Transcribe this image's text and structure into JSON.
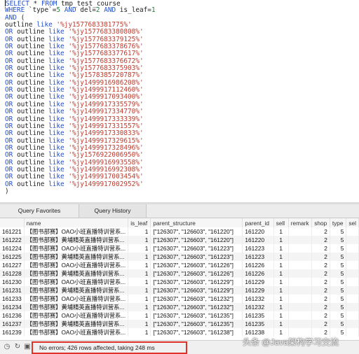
{
  "editor": {
    "lines": [
      {
        "parts": [
          {
            "t": "SELECT",
            "c": "kw"
          },
          {
            "t": " * ",
            "c": ""
          },
          {
            "t": "FROM",
            "c": "kw"
          },
          {
            "t": " tmp_test_course",
            "c": ""
          }
        ],
        "caret": true
      },
      {
        "parts": [
          {
            "t": "WHERE",
            "c": "kw"
          },
          {
            "t": " `type`=",
            "c": ""
          },
          {
            "t": "5",
            "c": "num"
          },
          {
            "t": " ",
            "c": ""
          },
          {
            "t": "AND",
            "c": "kw"
          },
          {
            "t": " del=",
            "c": ""
          },
          {
            "t": "2",
            "c": "num"
          },
          {
            "t": " ",
            "c": ""
          },
          {
            "t": "AND",
            "c": "kw"
          },
          {
            "t": " is_leaf=",
            "c": ""
          },
          {
            "t": "1",
            "c": "num"
          }
        ]
      },
      {
        "parts": [
          {
            "t": "AND",
            "c": "kw"
          },
          {
            "t": " (",
            "c": ""
          }
        ]
      },
      {
        "parts": [
          {
            "t": "outline ",
            "c": ""
          },
          {
            "t": "like",
            "c": "kw"
          },
          {
            "t": " ",
            "c": ""
          },
          {
            "t": "'%jy1577683381775%'",
            "c": "str"
          }
        ]
      },
      {
        "parts": [
          {
            "t": "OR",
            "c": "kw"
          },
          {
            "t": " outline ",
            "c": ""
          },
          {
            "t": "like",
            "c": "kw"
          },
          {
            "t": " ",
            "c": ""
          },
          {
            "t": "'%jy1577683380808%'",
            "c": "str"
          }
        ]
      },
      {
        "parts": [
          {
            "t": "OR",
            "c": "kw"
          },
          {
            "t": " outline ",
            "c": ""
          },
          {
            "t": "like",
            "c": "kw"
          },
          {
            "t": " ",
            "c": ""
          },
          {
            "t": "'%jy1577683379125%'",
            "c": "str"
          }
        ]
      },
      {
        "parts": [
          {
            "t": "OR",
            "c": "kw"
          },
          {
            "t": " outline ",
            "c": ""
          },
          {
            "t": "like",
            "c": "kw"
          },
          {
            "t": " ",
            "c": ""
          },
          {
            "t": "'%jy1577683378676%'",
            "c": "str"
          }
        ]
      },
      {
        "parts": [
          {
            "t": "OR",
            "c": "kw"
          },
          {
            "t": " outline ",
            "c": ""
          },
          {
            "t": "like",
            "c": "kw"
          },
          {
            "t": " ",
            "c": ""
          },
          {
            "t": "'%jy1577683377617%'",
            "c": "str"
          }
        ]
      },
      {
        "parts": [
          {
            "t": "OR",
            "c": "kw"
          },
          {
            "t": " outline ",
            "c": ""
          },
          {
            "t": "like",
            "c": "kw"
          },
          {
            "t": " ",
            "c": ""
          },
          {
            "t": "'%jy1577683376672%'",
            "c": "str"
          }
        ]
      },
      {
        "parts": [
          {
            "t": "OR",
            "c": "kw"
          },
          {
            "t": " outline ",
            "c": ""
          },
          {
            "t": "like",
            "c": "kw"
          },
          {
            "t": " ",
            "c": ""
          },
          {
            "t": "'%jy1577683375903%'",
            "c": "str"
          }
        ]
      },
      {
        "parts": [
          {
            "t": "OR",
            "c": "kw"
          },
          {
            "t": " outline ",
            "c": ""
          },
          {
            "t": "like",
            "c": "kw"
          },
          {
            "t": " ",
            "c": ""
          },
          {
            "t": "'%jy1578385720787%'",
            "c": "str"
          }
        ]
      },
      {
        "parts": [
          {
            "t": "OR",
            "c": "kw"
          },
          {
            "t": " outline ",
            "c": ""
          },
          {
            "t": "like",
            "c": "kw"
          },
          {
            "t": " ",
            "c": ""
          },
          {
            "t": "'%jy1499916986208%'",
            "c": "str"
          }
        ]
      },
      {
        "parts": [
          {
            "t": "OR",
            "c": "kw"
          },
          {
            "t": " outline ",
            "c": ""
          },
          {
            "t": "like",
            "c": "kw"
          },
          {
            "t": " ",
            "c": ""
          },
          {
            "t": "'%jy1499917112460%'",
            "c": "str"
          }
        ]
      },
      {
        "parts": [
          {
            "t": "OR",
            "c": "kw"
          },
          {
            "t": " outline ",
            "c": ""
          },
          {
            "t": "like",
            "c": "kw"
          },
          {
            "t": " ",
            "c": ""
          },
          {
            "t": "'%jy1499917093400%'",
            "c": "str"
          }
        ]
      },
      {
        "parts": [
          {
            "t": "OR",
            "c": "kw"
          },
          {
            "t": " outline ",
            "c": ""
          },
          {
            "t": "like",
            "c": "kw"
          },
          {
            "t": " ",
            "c": ""
          },
          {
            "t": "'%jy1499917335579%'",
            "c": "str"
          }
        ]
      },
      {
        "parts": [
          {
            "t": "OR",
            "c": "kw"
          },
          {
            "t": " outline ",
            "c": ""
          },
          {
            "t": "like",
            "c": "kw"
          },
          {
            "t": " ",
            "c": ""
          },
          {
            "t": "'%jy1499917334770%'",
            "c": "str"
          }
        ]
      },
      {
        "parts": [
          {
            "t": "OR",
            "c": "kw"
          },
          {
            "t": " outline ",
            "c": ""
          },
          {
            "t": "like",
            "c": "kw"
          },
          {
            "t": " ",
            "c": ""
          },
          {
            "t": "'%jy1499917333339%'",
            "c": "str"
          }
        ]
      },
      {
        "parts": [
          {
            "t": "OR",
            "c": "kw"
          },
          {
            "t": " outline ",
            "c": ""
          },
          {
            "t": "like",
            "c": "kw"
          },
          {
            "t": " ",
            "c": ""
          },
          {
            "t": "'%jy1499917331557%'",
            "c": "str"
          }
        ]
      },
      {
        "parts": [
          {
            "t": "OR",
            "c": "kw"
          },
          {
            "t": " outline ",
            "c": ""
          },
          {
            "t": "like",
            "c": "kw"
          },
          {
            "t": " ",
            "c": ""
          },
          {
            "t": "'%jy1499917330833%'",
            "c": "str"
          }
        ]
      },
      {
        "parts": [
          {
            "t": "OR",
            "c": "kw"
          },
          {
            "t": " outline ",
            "c": ""
          },
          {
            "t": "like",
            "c": "kw"
          },
          {
            "t": " ",
            "c": ""
          },
          {
            "t": "'%jy1499917329615%'",
            "c": "str"
          }
        ]
      },
      {
        "parts": [
          {
            "t": "OR",
            "c": "kw"
          },
          {
            "t": " outline ",
            "c": ""
          },
          {
            "t": "like",
            "c": "kw"
          },
          {
            "t": " ",
            "c": ""
          },
          {
            "t": "'%jy1499917328496%'",
            "c": "str"
          }
        ]
      },
      {
        "parts": [
          {
            "t": "OR",
            "c": "kw"
          },
          {
            "t": " outline ",
            "c": ""
          },
          {
            "t": "like",
            "c": "kw"
          },
          {
            "t": " ",
            "c": ""
          },
          {
            "t": "'%jy1576922006950%'",
            "c": "str"
          }
        ]
      },
      {
        "parts": [
          {
            "t": "OR",
            "c": "kw"
          },
          {
            "t": " outline ",
            "c": ""
          },
          {
            "t": "like",
            "c": "kw"
          },
          {
            "t": " ",
            "c": ""
          },
          {
            "t": "'%jy1499916993558%'",
            "c": "str"
          }
        ]
      },
      {
        "parts": [
          {
            "t": "OR",
            "c": "kw"
          },
          {
            "t": " outline ",
            "c": ""
          },
          {
            "t": "like",
            "c": "kw"
          },
          {
            "t": " ",
            "c": ""
          },
          {
            "t": "'%jy1499916992308%'",
            "c": "str"
          }
        ]
      },
      {
        "parts": [
          {
            "t": "OR",
            "c": "kw"
          },
          {
            "t": " outline ",
            "c": ""
          },
          {
            "t": "like",
            "c": "kw"
          },
          {
            "t": " ",
            "c": ""
          },
          {
            "t": "'%jy1499917003454%'",
            "c": "str"
          }
        ]
      },
      {
        "parts": [
          {
            "t": "OR",
            "c": "kw"
          },
          {
            "t": " outline ",
            "c": ""
          },
          {
            "t": "like",
            "c": "kw"
          },
          {
            "t": " ",
            "c": ""
          },
          {
            "t": "'%jy1499917002952%'",
            "c": "str"
          }
        ]
      },
      {
        "parts": [
          {
            "t": ")",
            "c": ""
          }
        ]
      }
    ]
  },
  "tabs": {
    "query_favorites": "Query Favorites",
    "query_history": "Query History"
  },
  "grid": {
    "columns": [
      "",
      "name",
      "is_leaf",
      "parent_structure",
      "parent_id",
      "sell",
      "remark",
      "shop",
      "type",
      "sel"
    ],
    "rows": [
      [
        "161221",
        "【图书部赛】OAO小班直播特训营系...",
        "1",
        "[\"126307\", \"126603\", \"161220\"]",
        "161220",
        "1",
        "",
        "2",
        "5",
        ""
      ],
      [
        "161222",
        "【图书部赛】黄埔精英直播特训营系...",
        "1",
        "[\"126307\", \"126603\", \"161220\"]",
        "161220",
        "1",
        "",
        "2",
        "5",
        ""
      ],
      [
        "161224",
        "【图书部赛】OAO小班直播特训营系...",
        "1",
        "[\"126307\", \"126603\", \"161223\"]",
        "161223",
        "1",
        "",
        "2",
        "5",
        ""
      ],
      [
        "161225",
        "【图书部赛】黄埔精英直播特训营系...",
        "1",
        "[\"126307\", \"126603\", \"161223\"]",
        "161223",
        "1",
        "",
        "2",
        "5",
        ""
      ],
      [
        "161227",
        "【图书部赛】OAO小班直播特训营系...",
        "1",
        "[\"126307\", \"126603\", \"161226\"]",
        "161226",
        "1",
        "",
        "2",
        "5",
        ""
      ],
      [
        "161228",
        "【图书部赛】黄埔精英直播特训营系...",
        "1",
        "[\"126307\", \"126603\", \"161226\"]",
        "161226",
        "1",
        "",
        "2",
        "5",
        ""
      ],
      [
        "161230",
        "【图书部赛】OAO小班直播特训营系...",
        "1",
        "[\"126307\", \"126603\", \"161229\"]",
        "161229",
        "1",
        "",
        "2",
        "5",
        ""
      ],
      [
        "161231",
        "【图书部赛】黄埔精英直播特训营系...",
        "1",
        "[\"126307\", \"126603\", \"161229\"]",
        "161229",
        "1",
        "",
        "2",
        "5",
        ""
      ],
      [
        "161233",
        "【图书部赛】OAO小班直播特训营系...",
        "1",
        "[\"126307\", \"126603\", \"161232\"]",
        "161232",
        "1",
        "",
        "2",
        "5",
        ""
      ],
      [
        "161234",
        "【图书部赛】黄埔精英直播特训营系...",
        "1",
        "[\"126307\", \"126603\", \"161232\"]",
        "161232",
        "1",
        "",
        "2",
        "5",
        ""
      ],
      [
        "161236",
        "【图书部赛】OAO小班直播特训营系...",
        "1",
        "[\"126307\", \"126603\", \"161235\"]",
        "161235",
        "1",
        "",
        "2",
        "5",
        ""
      ],
      [
        "161237",
        "【图书部赛】黄埔精英直播特训营系...",
        "1",
        "[\"126307\", \"126603\", \"161235\"]",
        "161235",
        "1",
        "",
        "2",
        "5",
        ""
      ],
      [
        "161239",
        "【图书部赛】OAO小班直播特训营系...",
        "1",
        "[\"126307\", \"126603\", \"161238\"]",
        "161238",
        "1",
        "",
        "2",
        "5",
        ""
      ]
    ]
  },
  "status": {
    "message": "No errors; 426 rows affected, taking 248 ms",
    "icons": [
      "history-icon",
      "refresh-icon",
      "export-icon"
    ]
  },
  "watermark": "头条 @Java架构学习交流",
  "colors": {
    "keyword": "#1f4fd1",
    "string": "#c0392b",
    "number": "#1a7f3a",
    "highlight_border": "#e0312b"
  }
}
